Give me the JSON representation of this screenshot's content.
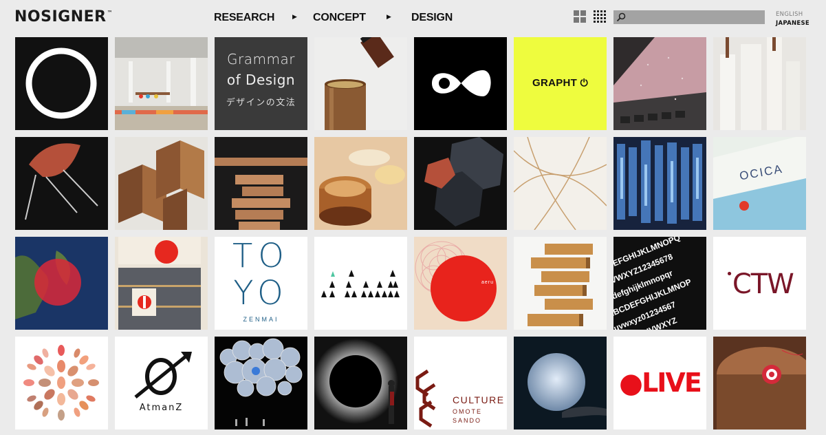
{
  "header": {
    "logo": "NOSIGNER",
    "logo_tm": "™",
    "nav": [
      {
        "label": "RESEARCH"
      },
      {
        "label": "CONCEPT"
      },
      {
        "label": "DESIGN"
      }
    ],
    "view_modes": [
      "large-grid-view",
      "small-grid-view"
    ],
    "search": {
      "placeholder": "",
      "value": ""
    },
    "languages": [
      {
        "label": "ENGLISH",
        "active": false
      },
      {
        "label": "JAPANESE",
        "active": true
      }
    ]
  },
  "tiles": {
    "grammar": {
      "line1": "Grammar",
      "line2": "of Design",
      "line3": "デザインの文法"
    },
    "graphit": {
      "label": "GRAPHT",
      "bg": "#eefc3e"
    },
    "ocica": {
      "label": "OCICA"
    },
    "toyo": {
      "row1": "TO",
      "row2": "YO",
      "sub": "ZENMAI",
      "color": "#1e5e86"
    },
    "aeru": {
      "label": "aeru"
    },
    "ctw": {
      "label": "CTW",
      "color": "#7a1628"
    },
    "atmanz": {
      "label": "AtmanZ"
    },
    "culture": {
      "line1": "CULTURE",
      "line2": "OMOTE",
      "line3": "SANDO",
      "color": "#7a1b13"
    },
    "live": {
      "label": "LIVE",
      "color": "#e8101a"
    }
  }
}
